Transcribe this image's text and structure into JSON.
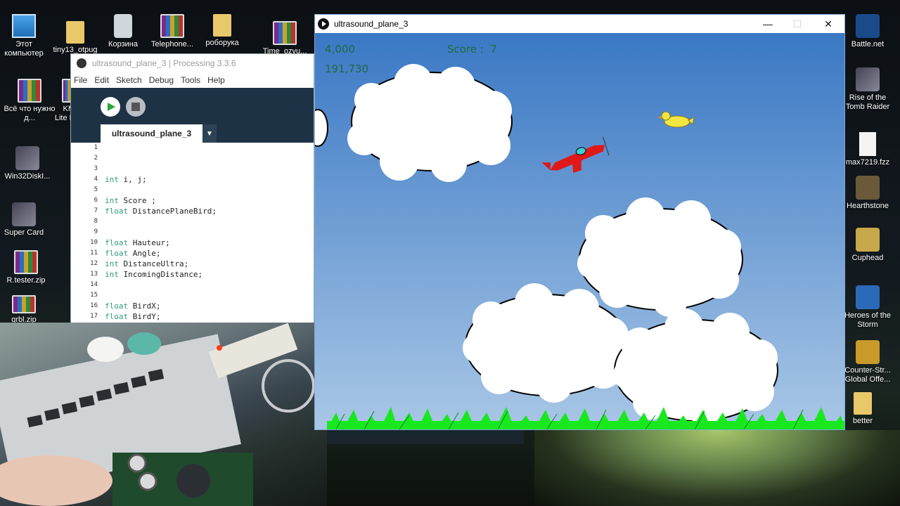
{
  "desktop": {
    "icons_left": [
      {
        "label": "Этот компьютер",
        "icon": "computer-icon"
      },
      {
        "label": "Всё что нужно д...",
        "icon": "winrar-archive-icon"
      },
      {
        "label": "Win32DiskI...",
        "icon": "disk-imager-icon"
      },
      {
        "label": "Super Card",
        "icon": "super-card-icon"
      },
      {
        "label": "R.tester.zip",
        "icon": "winrar-archive-icon"
      },
      {
        "label": "grbl.zip",
        "icon": "winrar-archive-icon"
      }
    ],
    "icons_top": [
      {
        "label": "tiny13_otpug",
        "icon": "folder-icon"
      },
      {
        "label": "Корзина",
        "icon": "recycle-bin-icon"
      },
      {
        "label": "Telephone...",
        "icon": "winrar-archive-icon"
      },
      {
        "label": "роборука",
        "icon": "folder-icon"
      },
      {
        "label": "Time_ozvu...",
        "icon": "winrar-archive-icon"
      },
      {
        "label": "KM Lite P",
        "icon": "winrar-archive-icon"
      }
    ],
    "icons_right": [
      {
        "label": "Battle.net",
        "icon": "battlenet-icon"
      },
      {
        "label": "Rise of the Tomb Raider",
        "icon": "tomb-raider-icon"
      },
      {
        "label": "max7219.fzz",
        "icon": "file-icon"
      },
      {
        "label": "Hearthstone",
        "icon": "hearthstone-icon"
      },
      {
        "label": "Cuphead",
        "icon": "cuphead-icon"
      },
      {
        "label": "Heroes of the Storm",
        "icon": "heroes-icon"
      },
      {
        "label": "Counter-Str... Global Offe...",
        "icon": "csgo-icon"
      },
      {
        "label": "better",
        "icon": "folder-icon"
      }
    ]
  },
  "ide": {
    "title": "ultrasound_plane_3 | Processing 3.3.6",
    "menu": [
      "File",
      "Edit",
      "Sketch",
      "Debug",
      "Tools",
      "Help"
    ],
    "tab_label": "ultrasound_plane_3",
    "tab_menu_glyph": "▼",
    "line_numbers": [
      "1",
      "2",
      "3",
      "4",
      "5",
      "6",
      "7",
      "8",
      "9",
      "10",
      "11",
      "12",
      "13",
      "14",
      "15",
      "16",
      "17"
    ],
    "code": [
      {
        "kw": "",
        "rest": ""
      },
      {
        "kw": "",
        "rest": ""
      },
      {
        "kw": "",
        "rest": ""
      },
      {
        "kw": "int",
        "rest": " i, j;"
      },
      {
        "kw": "",
        "rest": ""
      },
      {
        "kw": "int",
        "rest": " Score ;"
      },
      {
        "kw": "float",
        "rest": " DistancePlaneBird;"
      },
      {
        "kw": "",
        "rest": ""
      },
      {
        "kw": "",
        "rest": ""
      },
      {
        "kw": "float",
        "rest": " Hauteur;"
      },
      {
        "kw": "float",
        "rest": " Angle;"
      },
      {
        "kw": "int",
        "rest": " DistanceUltra;"
      },
      {
        "kw": "int",
        "rest": " IncomingDistance;"
      },
      {
        "kw": "",
        "rest": ""
      },
      {
        "kw": "",
        "rest": ""
      },
      {
        "kw": "float",
        "rest": " BirdX;"
      },
      {
        "kw": "float",
        "rest": " BirdY;"
      }
    ],
    "accent_color": "#1e3246",
    "keyword_color": "#33997e"
  },
  "game": {
    "title": "ultrasound_plane_3",
    "controls": {
      "minimize": "—",
      "maximize": "☐",
      "close": "✕"
    },
    "hud": {
      "value1": "4,000",
      "value2": "191,730",
      "score_label": "Score :  7"
    },
    "colors": {
      "sky_top": "#3a78c4",
      "sky_bottom": "#a9c7e6",
      "grass": "#19e81f",
      "plane": "#e01818",
      "bird": "#f2e640",
      "hud_text": "#1e6b44"
    }
  }
}
